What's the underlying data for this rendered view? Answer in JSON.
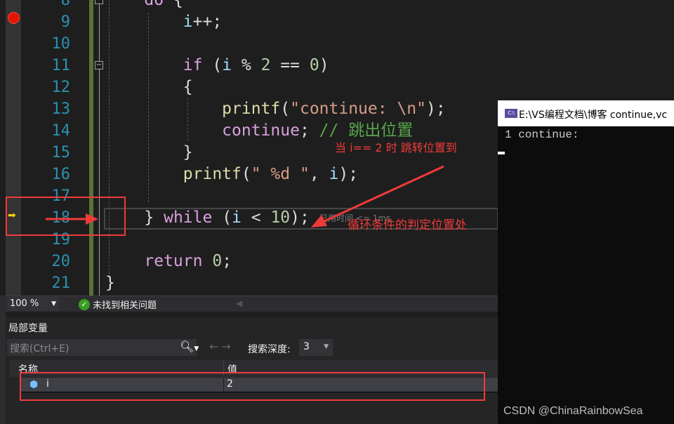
{
  "editor": {
    "lines": [
      {
        "num": "8",
        "tokens": [
          [
            "    ",
            "pn"
          ],
          [
            "do",
            "kw"
          ],
          [
            " {",
            "pn"
          ]
        ]
      },
      {
        "num": "9",
        "tokens": [
          [
            "        ",
            "pn"
          ],
          [
            "i",
            "var"
          ],
          [
            "++;",
            "pn"
          ]
        ]
      },
      {
        "num": "10",
        "tokens": []
      },
      {
        "num": "11",
        "tokens": [
          [
            "        ",
            "pn"
          ],
          [
            "if",
            "kw"
          ],
          [
            " (",
            "pn"
          ],
          [
            "i",
            "var"
          ],
          [
            " % ",
            "pn"
          ],
          [
            "2",
            "num"
          ],
          [
            " == ",
            "pn"
          ],
          [
            "0",
            "num"
          ],
          [
            ")",
            "pn"
          ]
        ]
      },
      {
        "num": "12",
        "tokens": [
          [
            "        {",
            "pn"
          ]
        ]
      },
      {
        "num": "13",
        "tokens": [
          [
            "            ",
            "pn"
          ],
          [
            "printf",
            "fn"
          ],
          [
            "(",
            "pn"
          ],
          [
            "\"continue: \\n\"",
            "str"
          ],
          [
            ");",
            "pn"
          ]
        ]
      },
      {
        "num": "14",
        "tokens": [
          [
            "            ",
            "pn"
          ],
          [
            "continue",
            "kw"
          ],
          [
            "; ",
            "pn"
          ],
          [
            "// 跳出位置",
            "cm"
          ]
        ]
      },
      {
        "num": "15",
        "tokens": [
          [
            "        }",
            "pn"
          ]
        ]
      },
      {
        "num": "16",
        "tokens": [
          [
            "        ",
            "pn"
          ],
          [
            "printf",
            "fn"
          ],
          [
            "(",
            "pn"
          ],
          [
            "\" %d \"",
            "str"
          ],
          [
            ", ",
            "pn"
          ],
          [
            "i",
            "var"
          ],
          [
            ");",
            "pn"
          ]
        ]
      },
      {
        "num": "17",
        "tokens": []
      },
      {
        "num": "18",
        "tokens": [
          [
            "    } ",
            "pn"
          ],
          [
            "while",
            "kw"
          ],
          [
            " (",
            "pn"
          ],
          [
            "i",
            "var"
          ],
          [
            " < ",
            "pn"
          ],
          [
            "10",
            "num"
          ],
          [
            ");",
            "pn"
          ]
        ]
      },
      {
        "num": "19",
        "tokens": []
      },
      {
        "num": "20",
        "tokens": [
          [
            "    ",
            "pn"
          ],
          [
            "return",
            "kw"
          ],
          [
            " ",
            "pn"
          ],
          [
            "0",
            "num"
          ],
          [
            ";",
            "pn"
          ]
        ]
      },
      {
        "num": "21",
        "tokens": [
          [
            "}",
            "pn"
          ]
        ]
      }
    ],
    "perf_tip": "已用时间 <= 1ms",
    "breakpoint_line": "9",
    "current_line": "18"
  },
  "status": {
    "zoom": "100 %",
    "issues": "未找到相关问题"
  },
  "locals": {
    "title": "局部变量",
    "search_placeholder": "搜索(Ctrl+E)",
    "depth_label": "搜索深度:",
    "depth_value": "3",
    "columns": [
      "名称",
      "值"
    ],
    "rows": [
      {
        "name": "i",
        "value": "2"
      }
    ]
  },
  "console": {
    "title": "E:\\VS编程文档\\博客 continue,vc",
    "icon_text": "C:\\",
    "output": "1 continue:"
  },
  "annotations": {
    "jump_note": "当 i== 2 时 跳转位置到",
    "target_note": "循环条件的判定位置处",
    "color": "#f03a3a"
  },
  "watermark": "CSDN @ChinaRainbowSea"
}
